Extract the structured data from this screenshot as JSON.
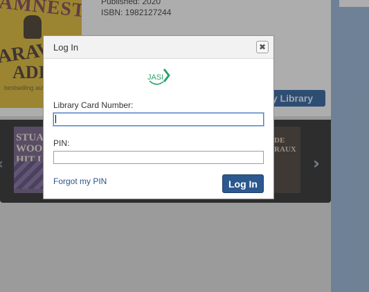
{
  "book": {
    "published": "Published: 2020",
    "isbn": "ISBN: 1982127244",
    "cover_line1": "AMNESTY",
    "cover_line2": "ARAVIND",
    "cover_line3": "ADI",
    "cover_small": "bestselling author of The W",
    "add_button": "y Library"
  },
  "carousel": {
    "book_left_text": "STUA\nWOO\nHIT L",
    "book_right_text": "DE\nRAUX"
  },
  "dialog": {
    "title": "Log In",
    "card_label": "Library Card Number:",
    "card_value": "",
    "pin_label": "PIN:",
    "pin_value": "",
    "forgot_link": "Forgot my PIN",
    "submit_label": "Log In",
    "logo_text": "JASI"
  },
  "colors": {
    "primary": "#2c5890",
    "logo_green": "#2aa36a",
    "link": "#2a5486"
  },
  "icons": {
    "close": "close-icon",
    "prev": "chevron-left-icon",
    "next": "chevron-right-icon"
  }
}
